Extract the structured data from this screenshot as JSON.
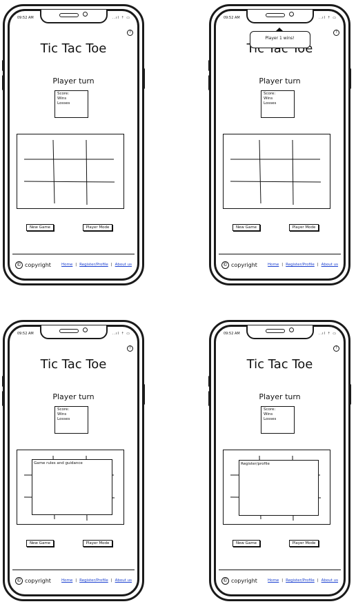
{
  "status": {
    "time": "09:52 AM",
    "icons": "..ıl ⇡ ▭"
  },
  "help_label": "?",
  "app_title": "Tic Tac Toe",
  "turn_label": "Player turn",
  "score": {
    "heading": "Score:",
    "wins": "Wins",
    "losses": "Losses"
  },
  "buttons": {
    "new_game": "New Game",
    "player_mode": "Player Mode"
  },
  "footer": {
    "copyright": "copyright",
    "copyright_symbol": "©",
    "links": [
      "Home",
      "Register/Profile",
      "About us"
    ]
  },
  "screens": [
    {
      "id": "game"
    },
    {
      "id": "win",
      "toast": "Player 1 wins!"
    },
    {
      "id": "rules",
      "modal": "Game rules and guidance"
    },
    {
      "id": "register",
      "modal": "Register/profile"
    }
  ]
}
